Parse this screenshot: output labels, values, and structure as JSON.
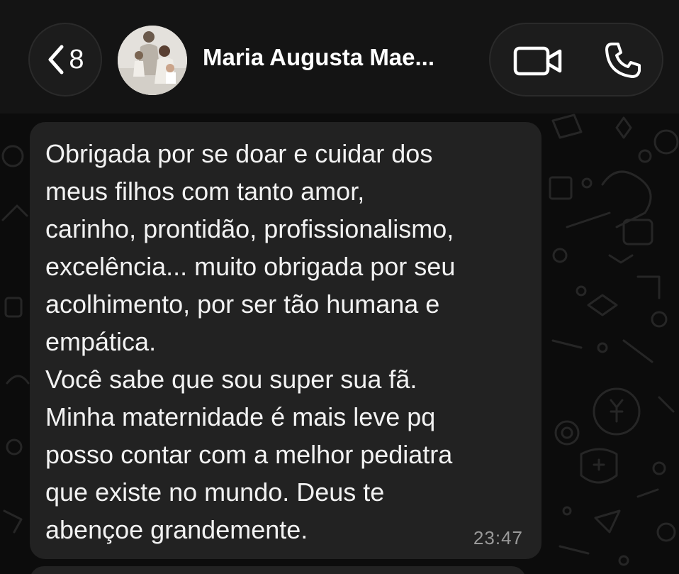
{
  "header": {
    "back_count": "8",
    "contact_name": "Maria Augusta Mae...",
    "icons": {
      "back": "chevron-left-icon",
      "video": "video-camera-icon",
      "phone": "phone-icon"
    }
  },
  "message": {
    "text": "Obrigada por se doar e cuidar dos\nmeus filhos com tanto amor,\ncarinho, prontidão, profissionalismo,\nexcelência... muito obrigada por seu\nacolhimento, por ser tão humana e\nempática.\nVocê sabe que sou super sua fã.\nMinha maternidade é mais leve pq\nposso contar com a melhor pediatra\nque existe no mundo. Deus te\nabençoe grandemente.",
    "time": "23:47"
  },
  "colors": {
    "background": "#0c0c0c",
    "header": "#141414",
    "bubble": "#222222",
    "text": "#f2f2f2",
    "timestamp": "#9a9a9a"
  }
}
